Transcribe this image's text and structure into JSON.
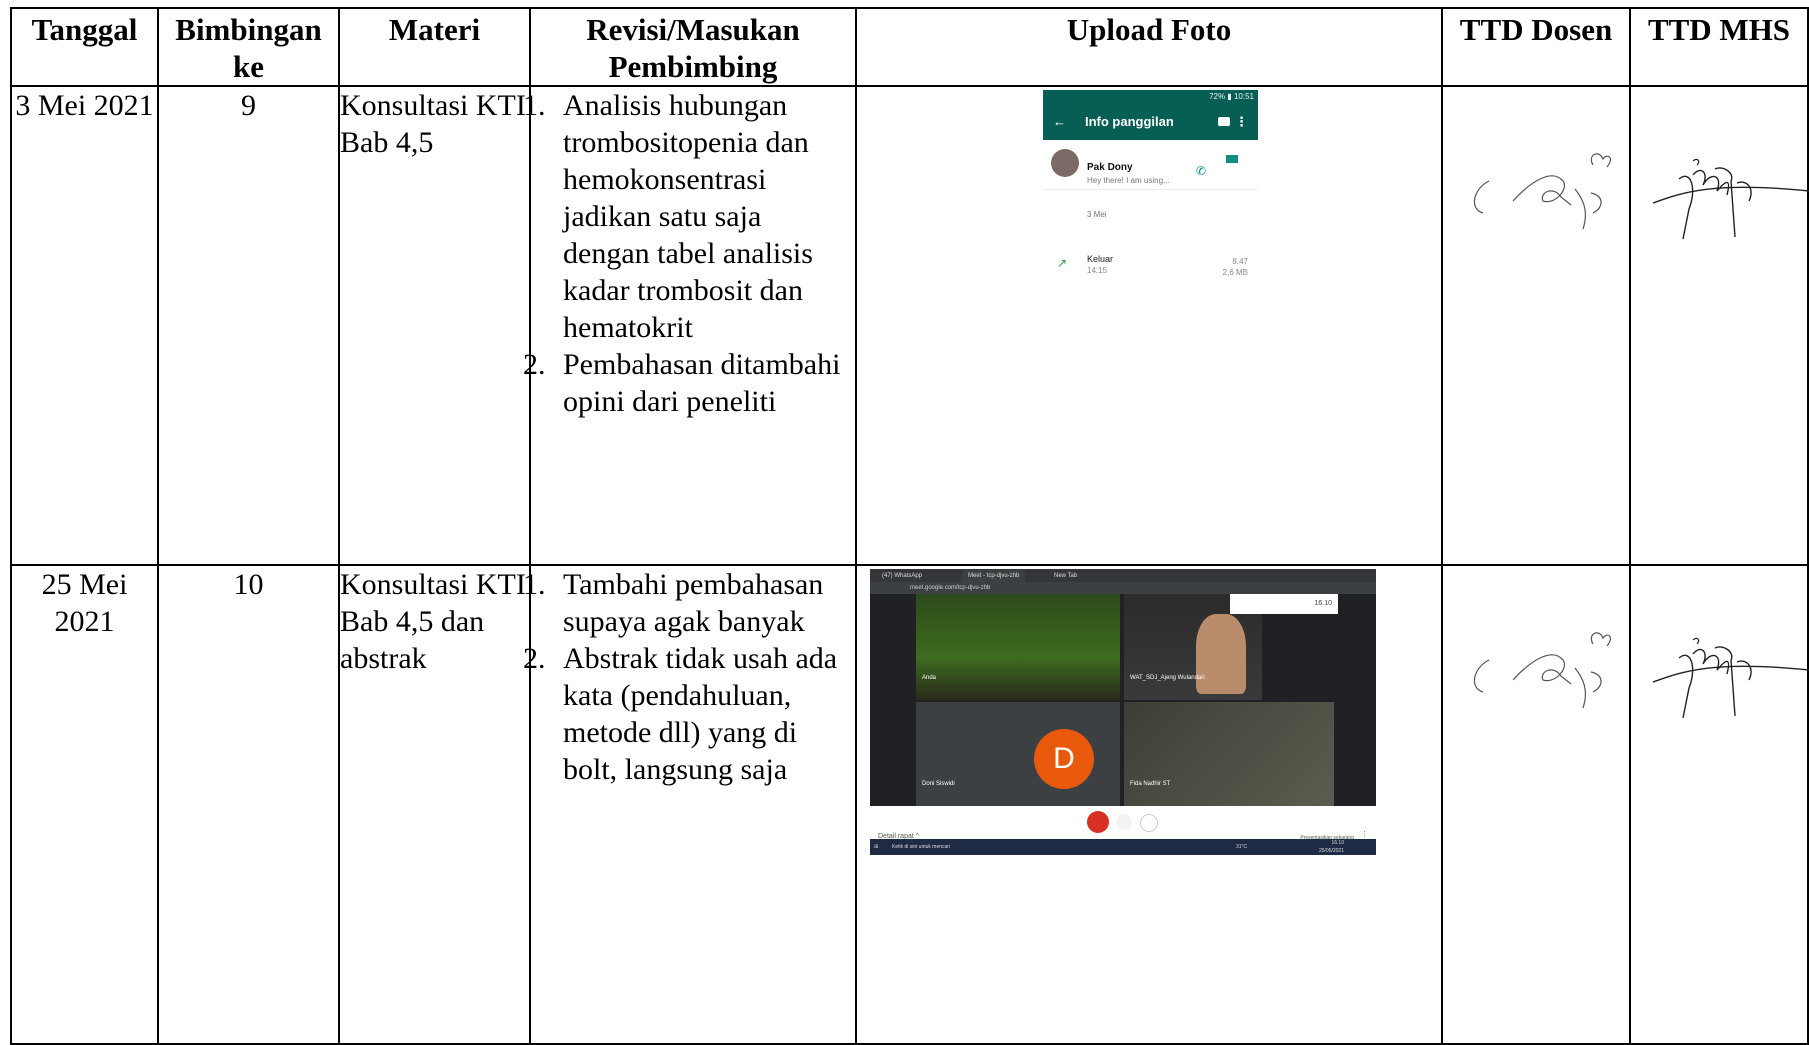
{
  "headers": {
    "tanggal": "Tanggal",
    "bimbingan": "Bimbingan ke",
    "materi": "Materi",
    "revisi": "Revisi/Masukan Pembimbing",
    "foto": "Upload Foto",
    "ttd_dosen": "TTD Dosen",
    "ttd_mhs": "TTD MHS"
  },
  "rows": [
    {
      "tanggal": "3 Mei 2021",
      "bimbingan": "9",
      "materi": "Konsultasi KTI Bab 4,5",
      "revisi": [
        "Analisis hubungan trombositopenia dan hemokonsentrasi jadikan satu saja dengan tabel analisis kadar trombosit dan hematokrit",
        "Pembahasan ditambahi opini dari peneliti"
      ]
    },
    {
      "tanggal": "25 Mei 2021",
      "bimbingan": "10",
      "materi": "Konsultasi KTI Bab 4,5 dan abstrak",
      "revisi": [
        "Tambahi pembahasan supaya agak banyak",
        "Abstrak tidak usah ada kata (pendahuluan, metode dll) yang di bolt, langsung saja"
      ]
    }
  ],
  "phone_screenshot": {
    "status_bar": "72% ▮ 10:51",
    "title": "Info panggilan",
    "contact_name": "Pak Dony",
    "contact_status": "Hey there! I am using...",
    "date": "3 Mei",
    "call_type": "Keluar",
    "call_time": "14:15",
    "duration": "8.47",
    "size": "2,6 MB"
  },
  "meet_screenshot": {
    "tabs": [
      "(47) WhatsApp",
      "Meet - tcp-djvu-zhb",
      "New Tab"
    ],
    "url": "meet.google.com/tcp-djvu-zhb",
    "clock": "16.10",
    "participants": [
      "Anda",
      "WAT_SDJ_Ajeng Wulandari",
      "Doni Siswidi",
      "Fida Nadhir ST"
    ],
    "avatar_letter": "D",
    "meeting_details": "Detail rapat ^",
    "present_now": "Presentasikan sekarang",
    "taskbar_search": "Ketik di sini untuk mencari",
    "taskbar_clock": "16.10",
    "taskbar_date": "25/05/2021",
    "taskbar_weather": "31°C"
  },
  "colors": {
    "whatsapp_green": "#075e54",
    "meet_end_red": "#d93025",
    "avatar_orange": "#e8590c"
  }
}
